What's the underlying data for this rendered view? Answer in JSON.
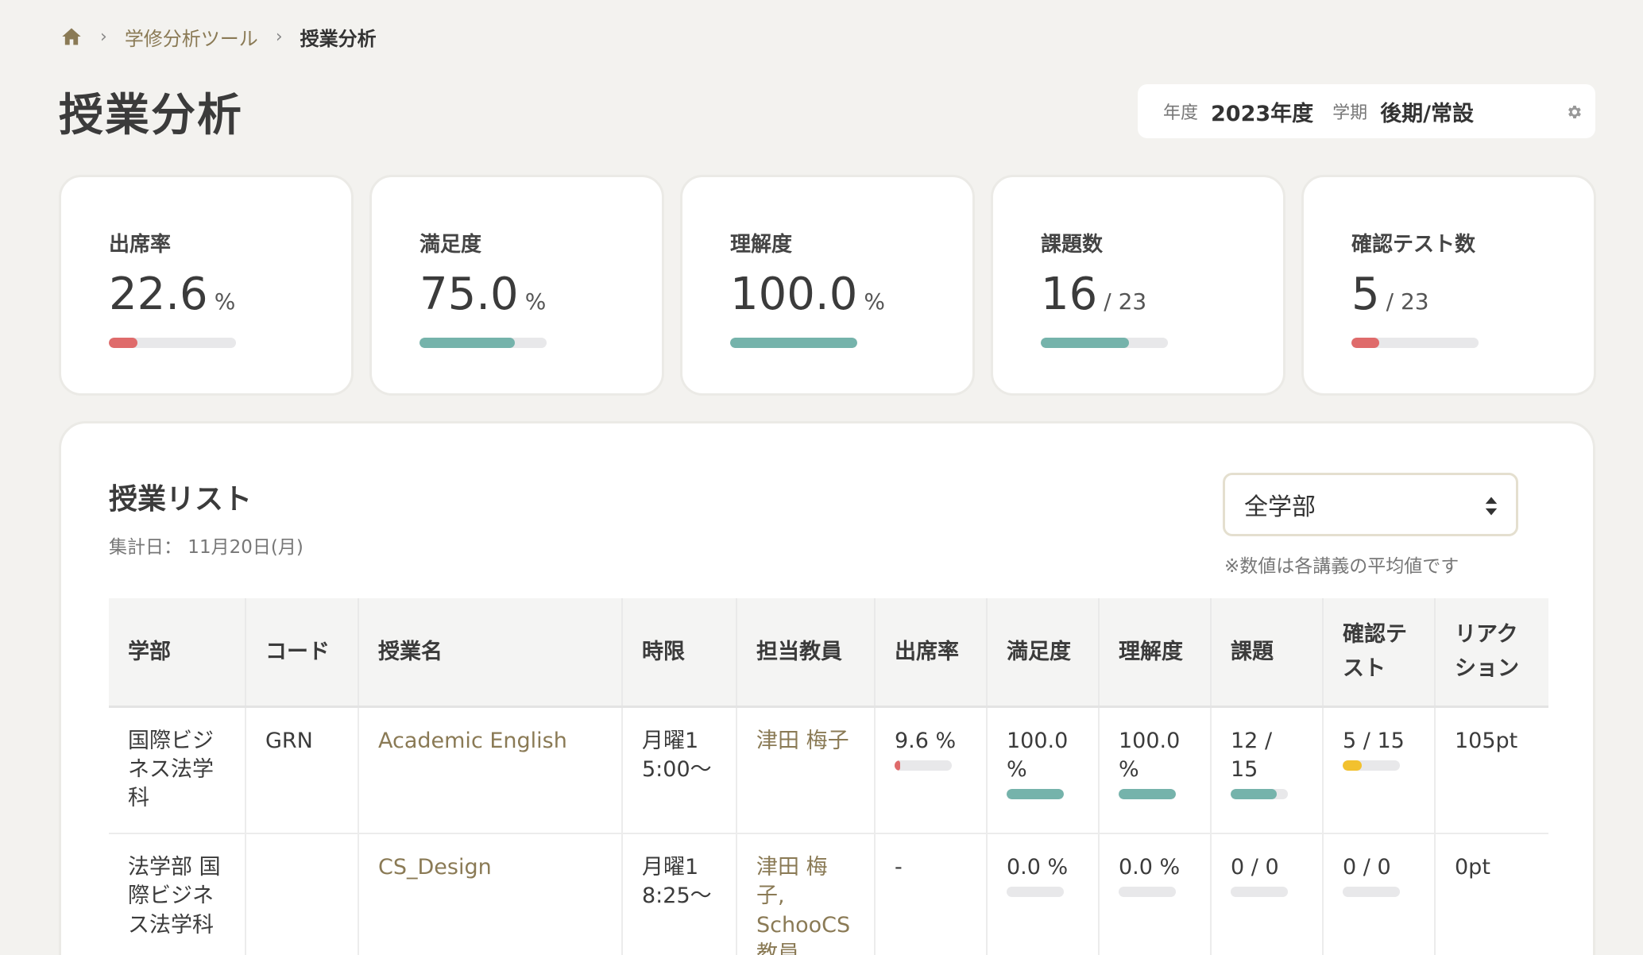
{
  "breadcrumb": {
    "parent": "学修分析ツール",
    "current": "授業分析",
    "separator": "›"
  },
  "page_title": "授業分析",
  "term": {
    "year_label": "年度",
    "year_value": "2023年度",
    "term_label": "学期",
    "term_value": "後期/常設"
  },
  "colors": {
    "accent": "#8a7a55",
    "teal": "#75b3ab",
    "red": "#df6b6b",
    "yellow": "#f2c12e"
  },
  "stats": [
    {
      "label": "出席率",
      "value": "22.6",
      "unit": "%",
      "fraction": 0.226,
      "color": "#df6b6b"
    },
    {
      "label": "満足度",
      "value": "75.0",
      "unit": "%",
      "fraction": 0.75,
      "color": "#75b3ab"
    },
    {
      "label": "理解度",
      "value": "100.0",
      "unit": "%",
      "fraction": 1.0,
      "color": "#75b3ab"
    },
    {
      "label": "課題数",
      "value": "16",
      "unit": "/ 23",
      "fraction": 0.696,
      "color": "#75b3ab"
    },
    {
      "label": "確認テスト数",
      "value": "5",
      "unit": "/ 23",
      "fraction": 0.217,
      "color": "#df6b6b"
    }
  ],
  "list": {
    "title": "授業リスト",
    "date": "集計日： 11月20日(月)",
    "select_value": "全学部",
    "note": "※数値は各講義の平均値です",
    "columns": [
      "学部",
      "コード",
      "授業名",
      "時限",
      "担当教員",
      "出席率",
      "満足度",
      "理解度",
      "課題",
      "確認テスト",
      "リアクション"
    ],
    "rows": [
      {
        "dept": "国際ビジネス法学科",
        "code": "GRN",
        "name": "Academic English",
        "period": "月曜1 5:00〜",
        "teacher": "津田 梅子",
        "attendance": "9.6 %",
        "attendance_frac": 0.096,
        "attendance_color": "#df6b6b",
        "satisfaction": "100.0 %",
        "satisfaction_frac": 1.0,
        "understanding": "100.0 %",
        "understanding_frac": 1.0,
        "tasks": "12 / 15",
        "tasks_frac": 0.8,
        "tests": "5 / 15",
        "tests_frac": 0.333,
        "reaction": "105pt"
      },
      {
        "dept": "法学部 国際ビジネス法学科",
        "code": "",
        "name": "CS_Design",
        "period": "月曜1 8:25〜",
        "teacher": "津田 梅子, SchooCS 教員",
        "attendance": "-",
        "satisfaction": "0.0 %",
        "satisfaction_frac": 0,
        "understanding": "0.0 %",
        "understanding_frac": 0,
        "tasks": "0 / 0",
        "tasks_frac": 0,
        "tests": "0 / 0",
        "tests_frac": 0,
        "reaction": "0pt"
      }
    ]
  }
}
